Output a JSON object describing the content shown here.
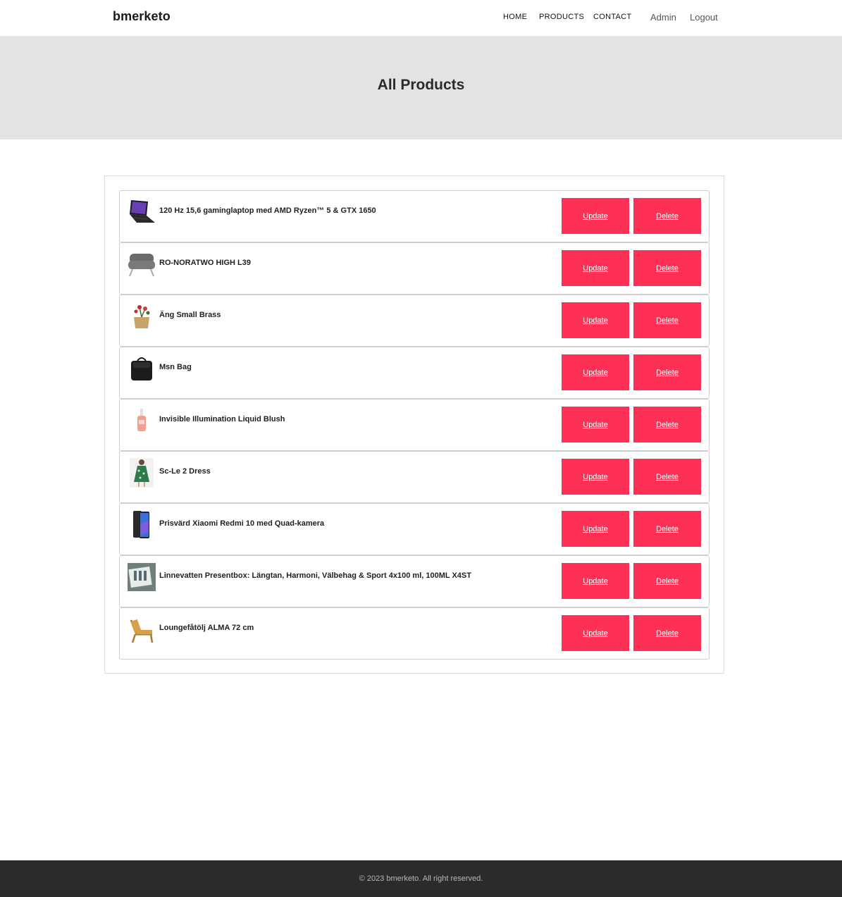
{
  "header": {
    "brand": "bmerketo",
    "nav": {
      "home": "HOME",
      "products": "PRODUCTS",
      "contact": "CONTACT"
    },
    "user": {
      "admin": "Admin",
      "logout": "Logout"
    }
  },
  "hero": {
    "title": "All Products"
  },
  "products": [
    {
      "name": "120 Hz 15,6 gaminglaptop med AMD Ryzen™ 5 & GTX 1650",
      "image": "laptop-thumbnail",
      "update_label": "Update",
      "delete_label": "Delete"
    },
    {
      "name": "RO-NORATWO HIGH L39",
      "image": "armchair-thumbnail",
      "update_label": "Update",
      "delete_label": "Delete"
    },
    {
      "name": "Äng Small Brass",
      "image": "flower-pot-thumbnail",
      "update_label": "Update",
      "delete_label": "Delete"
    },
    {
      "name": "Msn Bag",
      "image": "bag-thumbnail",
      "update_label": "Update",
      "delete_label": "Delete"
    },
    {
      "name": "Invisible Illumination Liquid Blush",
      "image": "blush-bottle-thumbnail",
      "update_label": "Update",
      "delete_label": "Delete"
    },
    {
      "name": "Sc-Le 2 Dress",
      "image": "dress-thumbnail",
      "update_label": "Update",
      "delete_label": "Delete"
    },
    {
      "name": "Prisvärd Xiaomi Redmi 10 med Quad-kamera",
      "image": "smartphone-thumbnail",
      "update_label": "Update",
      "delete_label": "Delete"
    },
    {
      "name": "Linnevatten Presentbox: Längtan, Harmoni, Välbehag & Sport 4x100 ml, 100ML X4ST",
      "image": "giftbox-thumbnail",
      "update_label": "Update",
      "delete_label": "Delete"
    },
    {
      "name": "Loungefåtölj ALMA 72 cm",
      "image": "lounge-chair-thumbnail",
      "update_label": "Update",
      "delete_label": "Delete"
    }
  ],
  "colors": {
    "accent": "#ff3055",
    "hero_bg": "#e3e3e3",
    "footer_bg": "#2b2b2b"
  },
  "footer": {
    "copyright": "© 2023 bmerketo. All right reserved."
  }
}
